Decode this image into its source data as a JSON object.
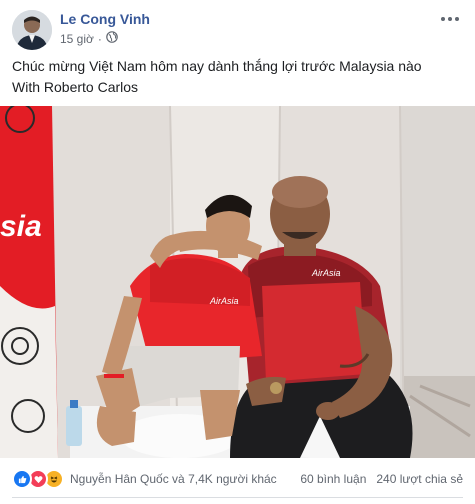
{
  "post": {
    "author": "Le Cong Vinh",
    "time": "15 giờ",
    "privacy_icon": "globe-icon",
    "caption_lines": [
      "Chúc mừng Việt Nam hôm nay dành thắng lợi trước Malaysia nào",
      "With Roberto Carlos"
    ],
    "photo": {
      "banner_text": "sia",
      "shirt_logo_left": "AirAsia",
      "shirt_logo_right": "AirAsia"
    }
  },
  "footer": {
    "reactions": [
      "like-icon",
      "love-icon",
      "haha-icon"
    ],
    "reaction_text": "Nguyễn Hân Quốc và 7,4K người khác",
    "comments": "60 bình luận",
    "shares": "240 lượt chia sẻ"
  },
  "colors": {
    "author_link": "#385898",
    "like_blue": "#1877f2",
    "love_red": "#f33e58",
    "haha_yellow": "#f7b125",
    "shirt_red": "#e8262b"
  }
}
